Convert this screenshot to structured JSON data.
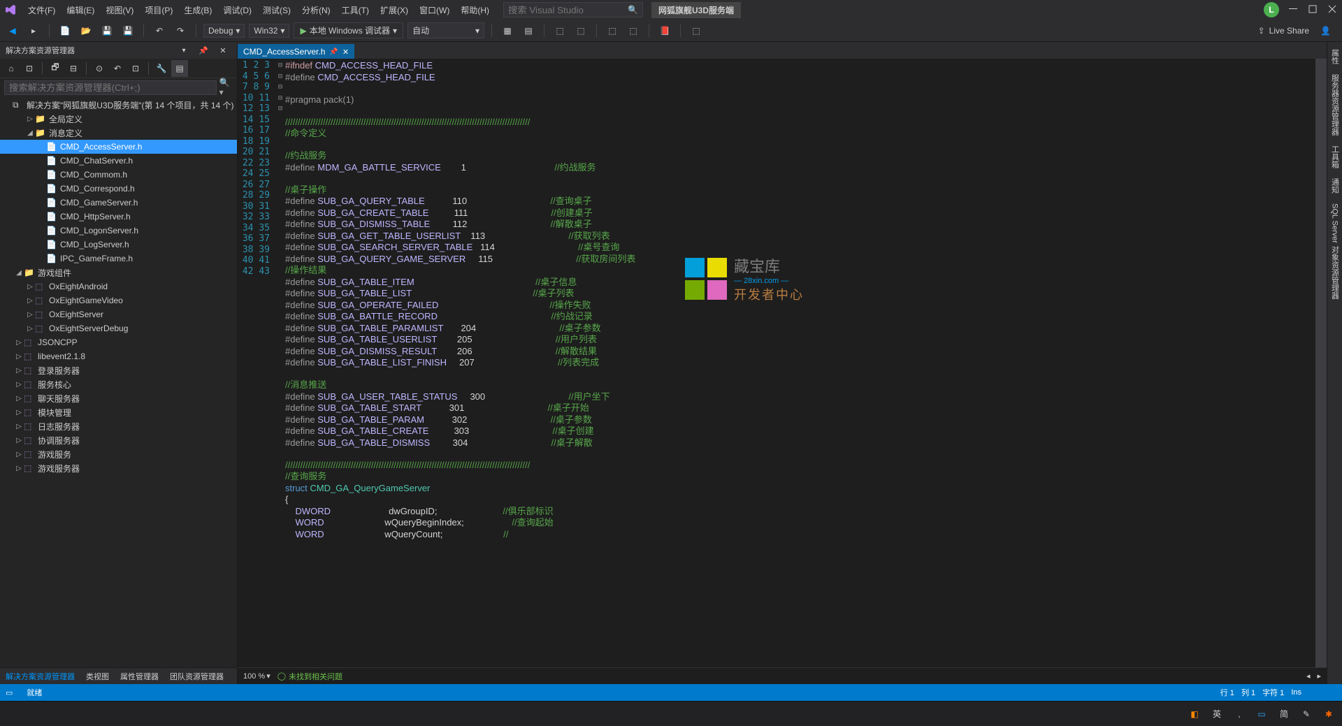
{
  "menubar": {
    "items": [
      "文件(F)",
      "编辑(E)",
      "视图(V)",
      "项目(P)",
      "生成(B)",
      "调试(D)",
      "测试(S)",
      "分析(N)",
      "工具(T)",
      "扩展(X)",
      "窗口(W)",
      "帮助(H)"
    ],
    "search_placeholder": "搜索 Visual Studio",
    "brand": "网狐旗舰U3D服务端",
    "avatar": "L"
  },
  "toolbar": {
    "config": "Debug",
    "platform": "Win32",
    "debugger": "本地 Windows 调试器",
    "auto": "自动",
    "liveshare": "Live Share"
  },
  "solution_panel": {
    "title": "解决方案资源管理器",
    "search_placeholder": "搜索解决方案资源管理器(Ctrl+;)",
    "root": "解决方案\"网狐旗舰U3D服务端\"(第 14 个项目，共 14 个)",
    "folders": [
      {
        "label": "全局定义",
        "expanded": false,
        "depth": 1,
        "type": "folder"
      },
      {
        "label": "消息定义",
        "expanded": true,
        "depth": 1,
        "type": "folder",
        "children": [
          {
            "label": "CMD_AccessServer.h",
            "type": "file",
            "selected": true
          },
          {
            "label": "CMD_ChatServer.h",
            "type": "file"
          },
          {
            "label": "CMD_Commom.h",
            "type": "file"
          },
          {
            "label": "CMD_Correspond.h",
            "type": "file"
          },
          {
            "label": "CMD_GameServer.h",
            "type": "file"
          },
          {
            "label": "CMD_HttpServer.h",
            "type": "file"
          },
          {
            "label": "CMD_LogonServer.h",
            "type": "file"
          },
          {
            "label": "CMD_LogServer.h",
            "type": "file"
          },
          {
            "label": "IPC_GameFrame.h",
            "type": "file"
          }
        ]
      },
      {
        "label": "游戏组件",
        "expanded": true,
        "depth": 0,
        "type": "folder",
        "children": [
          {
            "label": "OxEightAndroid",
            "type": "proj"
          },
          {
            "label": "OxEightGameVideo",
            "type": "proj"
          },
          {
            "label": "OxEightServer",
            "type": "proj"
          },
          {
            "label": "OxEightServerDebug",
            "type": "proj"
          }
        ]
      },
      {
        "label": "JSONCPP",
        "type": "proj",
        "depth": 0
      },
      {
        "label": "libevent2.1.8",
        "type": "proj",
        "depth": 0
      },
      {
        "label": "登录服务器",
        "type": "proj",
        "depth": 0
      },
      {
        "label": "服务核心",
        "type": "proj",
        "depth": 0
      },
      {
        "label": "聊天服务器",
        "type": "proj",
        "depth": 0
      },
      {
        "label": "模块管理",
        "type": "proj",
        "depth": 0
      },
      {
        "label": "日志服务器",
        "type": "proj",
        "depth": 0
      },
      {
        "label": "协调服务器",
        "type": "proj",
        "depth": 0
      },
      {
        "label": "游戏服务",
        "type": "proj",
        "depth": 0
      },
      {
        "label": "游戏服务器",
        "type": "proj",
        "depth": 0
      }
    ],
    "bottom_tabs": [
      "解决方案资源管理器",
      "类视图",
      "属性管理器",
      "团队资源管理器"
    ]
  },
  "editor": {
    "tab_name": "CMD_AccessServer.h",
    "zoom": "100 %",
    "no_issues": "未找到相关问题",
    "lines": [
      {
        "n": 1,
        "fold": "⊟",
        "seg": [
          [
            "ppk",
            "#ifndef "
          ],
          [
            "mac",
            "CMD_ACCESS_HEAD_FILE"
          ]
        ]
      },
      {
        "n": 2,
        "seg": [
          [
            "pp",
            "#define "
          ],
          [
            "mac",
            "CMD_ACCESS_HEAD_FILE"
          ]
        ]
      },
      {
        "n": 3,
        "seg": []
      },
      {
        "n": 4,
        "seg": [
          [
            "pp",
            "#pragma pack(1)"
          ]
        ]
      },
      {
        "n": 5,
        "seg": []
      },
      {
        "n": 6,
        "fold": "⊟",
        "seg": [
          [
            "cm",
            "/////////////////////////////////////////////////////////////////////////////////////////////////"
          ]
        ]
      },
      {
        "n": 7,
        "seg": [
          [
            "cm",
            "//命令定义"
          ]
        ]
      },
      {
        "n": 8,
        "seg": []
      },
      {
        "n": 9,
        "seg": [
          [
            "cm",
            "//约战服务"
          ]
        ]
      },
      {
        "n": 10,
        "seg": [
          [
            "pp",
            "#define "
          ],
          [
            "mac",
            "MDM_GA_BATTLE_SERVICE"
          ],
          [
            "plain",
            "        1                                   "
          ],
          [
            "cm",
            "//约战服务"
          ]
        ]
      },
      {
        "n": 11,
        "seg": []
      },
      {
        "n": 12,
        "seg": [
          [
            "cm",
            "//桌子操作"
          ]
        ]
      },
      {
        "n": 13,
        "seg": [
          [
            "pp",
            "#define "
          ],
          [
            "mac",
            "SUB_GA_QUERY_TABLE"
          ],
          [
            "plain",
            "           110                                 "
          ],
          [
            "cm",
            "//查询桌子"
          ]
        ]
      },
      {
        "n": 14,
        "seg": [
          [
            "pp",
            "#define "
          ],
          [
            "mac",
            "SUB_GA_CREATE_TABLE"
          ],
          [
            "plain",
            "          111                                 "
          ],
          [
            "cm",
            "//创建桌子"
          ]
        ]
      },
      {
        "n": 15,
        "seg": [
          [
            "pp",
            "#define "
          ],
          [
            "mac",
            "SUB_GA_DISMISS_TABLE"
          ],
          [
            "plain",
            "         112                                 "
          ],
          [
            "cm",
            "//解散桌子"
          ]
        ]
      },
      {
        "n": 16,
        "seg": [
          [
            "pp",
            "#define "
          ],
          [
            "mac",
            "SUB_GA_GET_TABLE_USERLIST"
          ],
          [
            "plain",
            "    113                                 "
          ],
          [
            "cm",
            "//获取列表"
          ]
        ]
      },
      {
        "n": 17,
        "seg": [
          [
            "pp",
            "#define "
          ],
          [
            "mac",
            "SUB_GA_SEARCH_SERVER_TABLE"
          ],
          [
            "plain",
            "   114                                 "
          ],
          [
            "cm",
            "//桌号查询"
          ]
        ]
      },
      {
        "n": 18,
        "fold": "⊟",
        "seg": [
          [
            "pp",
            "#define "
          ],
          [
            "mac",
            "SUB_GA_QUERY_GAME_SERVER"
          ],
          [
            "plain",
            "     115                                 "
          ],
          [
            "cm",
            "//获取房间列表"
          ]
        ]
      },
      {
        "n": 19,
        "seg": [
          [
            "cm",
            "//操作结果"
          ]
        ]
      },
      {
        "n": 20,
        "seg": [
          [
            "pp",
            "#define "
          ],
          [
            "mac",
            "SUB_GA_TABLE_ITEM"
          ],
          [
            "plain",
            "                                                "
          ],
          [
            "cm",
            "//桌子信息"
          ]
        ]
      },
      {
        "n": 21,
        "seg": [
          [
            "pp",
            "#define "
          ],
          [
            "mac",
            "SUB_GA_TABLE_LIST"
          ],
          [
            "plain",
            "                                                "
          ],
          [
            "cm",
            "//桌子列表"
          ]
        ]
      },
      {
        "n": 22,
        "seg": [
          [
            "pp",
            "#define "
          ],
          [
            "mac",
            "SUB_GA_OPERATE_FAILED"
          ],
          [
            "plain",
            "                                            "
          ],
          [
            "cm",
            "//操作失败"
          ]
        ]
      },
      {
        "n": 23,
        "seg": [
          [
            "pp",
            "#define "
          ],
          [
            "mac",
            "SUB_GA_BATTLE_RECORD"
          ],
          [
            "plain",
            "                                             "
          ],
          [
            "cm",
            "//约战记录"
          ]
        ]
      },
      {
        "n": 24,
        "seg": [
          [
            "pp",
            "#define "
          ],
          [
            "mac",
            "SUB_GA_TABLE_PARAMLIST"
          ],
          [
            "plain",
            "       204                                 "
          ],
          [
            "cm",
            "//桌子参数"
          ]
        ]
      },
      {
        "n": 25,
        "seg": [
          [
            "pp",
            "#define "
          ],
          [
            "mac",
            "SUB_GA_TABLE_USERLIST"
          ],
          [
            "plain",
            "        205                                 "
          ],
          [
            "cm",
            "//用户列表"
          ]
        ]
      },
      {
        "n": 26,
        "seg": [
          [
            "pp",
            "#define "
          ],
          [
            "mac",
            "SUB_GA_DISMISS_RESULT"
          ],
          [
            "plain",
            "        206                                 "
          ],
          [
            "cm",
            "//解散结果"
          ]
        ]
      },
      {
        "n": 27,
        "seg": [
          [
            "pp",
            "#define "
          ],
          [
            "mac",
            "SUB_GA_TABLE_LIST_FINISH"
          ],
          [
            "plain",
            "     207                                 "
          ],
          [
            "cm",
            "//列表完成"
          ]
        ]
      },
      {
        "n": 28,
        "seg": []
      },
      {
        "n": 29,
        "seg": [
          [
            "cm",
            "//消息推送"
          ]
        ]
      },
      {
        "n": 30,
        "seg": [
          [
            "pp",
            "#define "
          ],
          [
            "mac",
            "SUB_GA_USER_TABLE_STATUS"
          ],
          [
            "plain",
            "     300                                 "
          ],
          [
            "cm",
            "//用户坐下"
          ]
        ]
      },
      {
        "n": 31,
        "seg": [
          [
            "pp",
            "#define "
          ],
          [
            "mac",
            "SUB_GA_TABLE_START"
          ],
          [
            "plain",
            "           301                                 "
          ],
          [
            "cm",
            "//桌子开始"
          ]
        ]
      },
      {
        "n": 32,
        "seg": [
          [
            "pp",
            "#define "
          ],
          [
            "mac",
            "SUB_GA_TABLE_PARAM"
          ],
          [
            "plain",
            "           302                                 "
          ],
          [
            "cm",
            "//桌子参数"
          ]
        ]
      },
      {
        "n": 33,
        "seg": [
          [
            "pp",
            "#define "
          ],
          [
            "mac",
            "SUB_GA_TABLE_CREATE"
          ],
          [
            "plain",
            "          303                                 "
          ],
          [
            "cm",
            "//桌子创建"
          ]
        ]
      },
      {
        "n": 34,
        "seg": [
          [
            "pp",
            "#define "
          ],
          [
            "mac",
            "SUB_GA_TABLE_DISMISS"
          ],
          [
            "plain",
            "         304                                 "
          ],
          [
            "cm",
            "//桌子解散"
          ]
        ]
      },
      {
        "n": 35,
        "seg": []
      },
      {
        "n": 36,
        "fold": "⊟",
        "seg": [
          [
            "cm",
            "/////////////////////////////////////////////////////////////////////////////////////////////////"
          ]
        ]
      },
      {
        "n": 37,
        "seg": [
          [
            "cm",
            "//查询服务"
          ]
        ]
      },
      {
        "n": 38,
        "fold": "⊟",
        "seg": [
          [
            "kw",
            "struct "
          ],
          [
            "id",
            "CMD_GA_QueryGameServer"
          ]
        ]
      },
      {
        "n": 39,
        "seg": [
          [
            "plain",
            "{"
          ]
        ]
      },
      {
        "n": 40,
        "seg": [
          [
            "plain",
            "    "
          ],
          [
            "mac",
            "DWORD"
          ],
          [
            "plain",
            "                       dwGroupID;                          "
          ],
          [
            "cm",
            "//俱乐部标识"
          ]
        ]
      },
      {
        "n": 41,
        "seg": [
          [
            "plain",
            "    "
          ],
          [
            "mac",
            "WORD"
          ],
          [
            "plain",
            "                        wQueryBeginIndex;                   "
          ],
          [
            "cm",
            "//查询起始"
          ]
        ]
      },
      {
        "n": 42,
        "seg": [
          [
            "plain",
            "    "
          ],
          [
            "mac",
            "WORD"
          ],
          [
            "plain",
            "                        wQueryCount;                        "
          ],
          [
            "cm",
            "//"
          ]
        ]
      },
      {
        "n": 43,
        "seg": []
      }
    ]
  },
  "right_tabs": [
    "属性",
    "服务器资源管理器",
    "工具箱",
    "通知",
    "SQL Server 对象资源管理器"
  ],
  "statusbar": {
    "ready": "就绪",
    "line": "行 1",
    "col": "列 1",
    "char": "字符 1",
    "ins": "Ins"
  },
  "taskbar": {
    "ime": "英",
    "items": [
      ",",
      "简",
      "田"
    ]
  },
  "watermark": {
    "title": "藏宝库",
    "sub": "— 28xin.com —",
    "dev": "开发者中心"
  }
}
